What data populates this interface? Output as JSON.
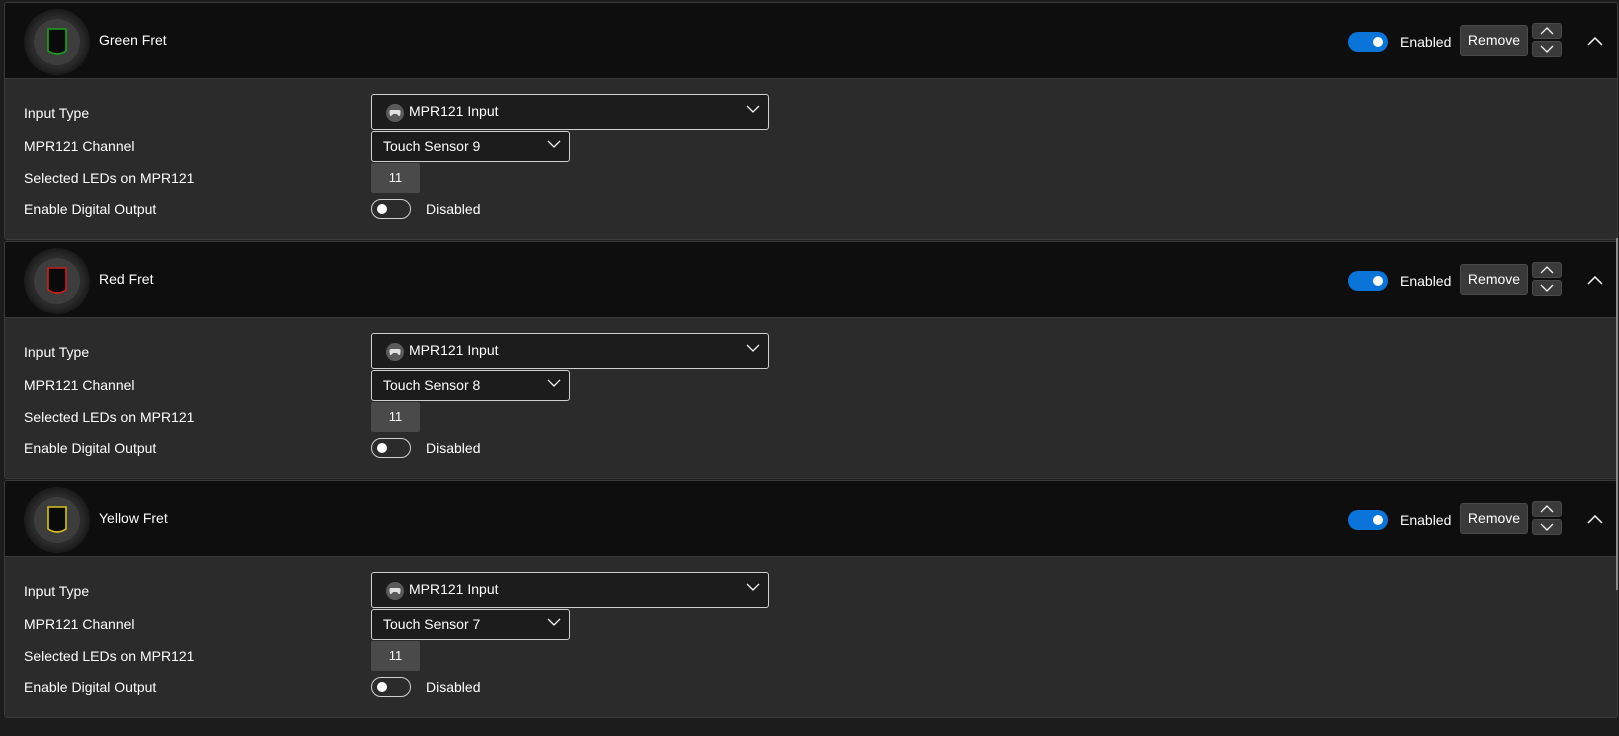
{
  "frets": [
    {
      "title": "Green Fret",
      "color": "#1ea21e",
      "enabled_label": "Enabled",
      "remove_label": "Remove",
      "labels": {
        "input_type": "Input Type",
        "channel": "MPR121 Channel",
        "leds": "Selected LEDs on MPR121",
        "digital_output": "Enable Digital Output"
      },
      "input_type_value": "MPR121 Input",
      "channel_value": "Touch Sensor 9",
      "leds_value": "11",
      "digital_output_state": "Disabled"
    },
    {
      "title": "Red Fret",
      "color": "#c81e1e",
      "enabled_label": "Enabled",
      "remove_label": "Remove",
      "labels": {
        "input_type": "Input Type",
        "channel": "MPR121 Channel",
        "leds": "Selected LEDs on MPR121",
        "digital_output": "Enable Digital Output"
      },
      "input_type_value": "MPR121 Input",
      "channel_value": "Touch Sensor 8",
      "leds_value": "11",
      "digital_output_state": "Disabled"
    },
    {
      "title": "Yellow Fret",
      "color": "#d8c21e",
      "enabled_label": "Enabled",
      "remove_label": "Remove",
      "labels": {
        "input_type": "Input Type",
        "channel": "MPR121 Channel",
        "leds": "Selected LEDs on MPR121",
        "digital_output": "Enable Digital Output"
      },
      "input_type_value": "MPR121 Input",
      "channel_value": "Touch Sensor 7",
      "leds_value": "11",
      "digital_output_state": "Disabled"
    }
  ],
  "icons": {
    "fret": "fret-shield-icon",
    "input": "gamepad-icon",
    "dropdown": "chevron-down-icon",
    "move_up": "chevron-up-icon",
    "move_down": "chevron-down-icon",
    "collapse": "chevron-up-icon"
  },
  "colors": {
    "toggle_on": "#0a74d8",
    "header_bg": "#0e0e0e",
    "body_bg": "#2b2b2b"
  }
}
